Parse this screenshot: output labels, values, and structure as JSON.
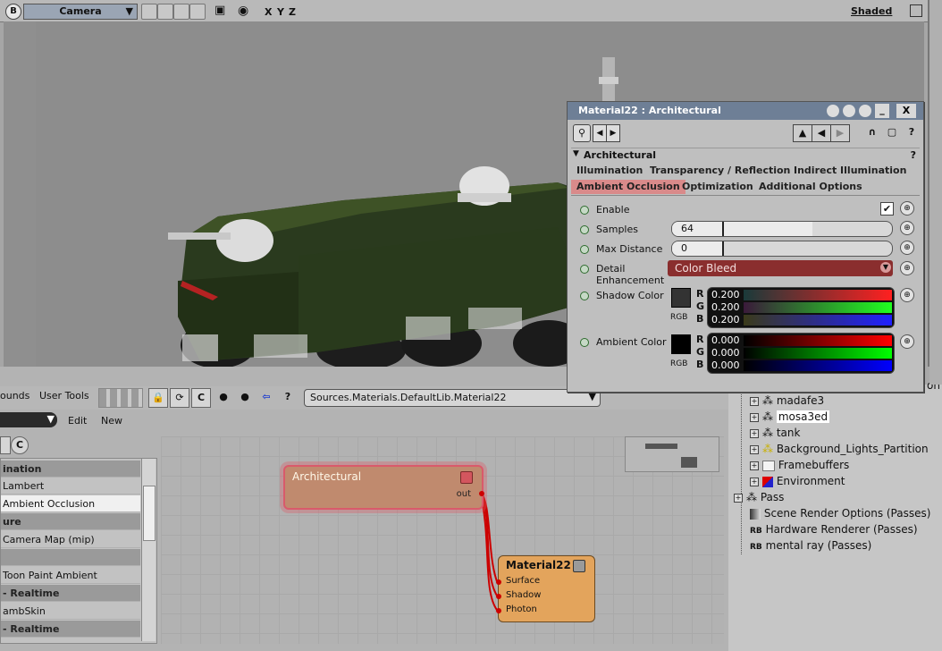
{
  "viewport": {
    "camera_label": "Camera",
    "axes": [
      "X",
      "Y",
      "Z"
    ],
    "shading": "Shaded"
  },
  "ppg": {
    "title": "Material22 : Architectural",
    "section": "Architectural",
    "tabs_row1": [
      "Illumination",
      "Transparency / Reflection",
      "Indirect Illumination"
    ],
    "tabs_row2": [
      "Ambient Occlusion",
      "Optimization",
      "Additional Options"
    ],
    "active_tab": "Ambient Occlusion",
    "params": {
      "enable_label": "Enable",
      "enable_checked": true,
      "samples_label": "Samples",
      "samples_value": "64",
      "samples_fraction": 0.64,
      "max_distance_label": "Max Distance",
      "max_distance_value": "0",
      "detail_label_1": "Detail",
      "detail_label_2": "Enhancement",
      "detail_value": "Color Bleed",
      "shadow_color_label": "Shadow Color",
      "shadow_rgb": [
        "0.200",
        "0.200",
        "0.200"
      ],
      "ambient_color_label": "Ambient Color",
      "ambient_rgb": [
        "0.000",
        "0.000",
        "0.000"
      ],
      "channels": [
        "R",
        "G",
        "B"
      ],
      "rgb_label": "RGB"
    }
  },
  "node_toolbar": {
    "tab_bounds": "ounds",
    "tab_user_tools": "User Tools",
    "path": "Sources.Materials.DefaultLib.Material22",
    "edit": "Edit",
    "new": "New"
  },
  "left_list": [
    {
      "label": "ination",
      "type": "hdr"
    },
    {
      "label": "Lambert",
      "type": "item"
    },
    {
      "label": "Ambient Occlusion",
      "type": "sel"
    },
    {
      "label": "ure",
      "type": "hdr"
    },
    {
      "label": "Camera Map (mip)",
      "type": "item"
    },
    {
      "label": "",
      "type": "hdr"
    },
    {
      "label": "Toon Paint Ambient",
      "type": "item"
    },
    {
      "label": "- Realtime",
      "type": "hdr"
    },
    {
      "label": "ambSkin",
      "type": "item"
    },
    {
      "label": "- Realtime",
      "type": "hdr"
    }
  ],
  "nodes": {
    "architectural": {
      "title": "Architectural",
      "port_out": "out"
    },
    "material": {
      "title": "Material22",
      "ports": [
        "Surface",
        "Shadow",
        "Photon"
      ]
    }
  },
  "explorer": {
    "partial_text": "on",
    "items": [
      {
        "label": "madafe3",
        "icon": "model-icon",
        "indent": 1
      },
      {
        "label": "mosa3ed",
        "icon": "model-icon",
        "indent": 1,
        "selected": true
      },
      {
        "label": "tank",
        "icon": "model-icon",
        "indent": 1
      },
      {
        "label": "Background_Lights_Partition",
        "icon": "partition-icon",
        "indent": 1
      },
      {
        "label": "Framebuffers",
        "icon": "folder-icon",
        "indent": 1
      },
      {
        "label": "Environment",
        "icon": "environment-icon",
        "indent": 1
      },
      {
        "label": "Pass",
        "icon": "pass-icon",
        "indent": 0
      },
      {
        "label": "Scene Render Options (Passes)",
        "icon": "render-options-icon",
        "indent": 0
      },
      {
        "label": "Hardware Renderer (Passes)",
        "icon": "renderer-icon",
        "indent": 0
      },
      {
        "label": "mental ray (Passes)",
        "icon": "renderer-icon",
        "indent": 0
      }
    ]
  },
  "colors": {
    "accent_tab": "#d98a8a",
    "color_bleed": "#8a2e2e",
    "node_arch": "#c08a6e",
    "node_mat": "#e3a45c",
    "wire": "#cc0000"
  }
}
